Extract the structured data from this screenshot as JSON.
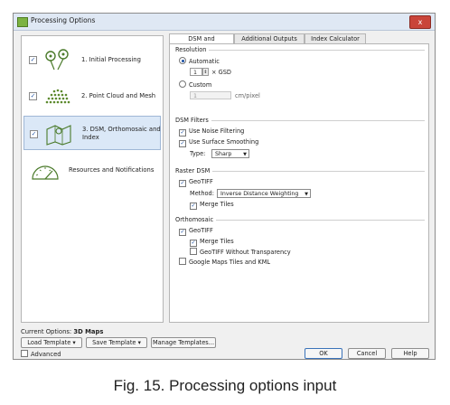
{
  "window": {
    "title": "Processing Options",
    "close_label": "x"
  },
  "steps": [
    {
      "label": "1. Initial Processing",
      "checked": true,
      "icon": "keypoints-icon"
    },
    {
      "label": "2. Point Cloud and Mesh",
      "checked": true,
      "icon": "point-cloud-icon"
    },
    {
      "label": "3. DSM, Orthomosaic and Index",
      "checked": true,
      "icon": "map-pins-icon"
    },
    {
      "label": "Resources and Notifications",
      "icon": "gauge-icon"
    }
  ],
  "tabs": [
    "DSM and Orthomosaic",
    "Additional Outputs",
    "Index Calculator"
  ],
  "resolution": {
    "title": "Resolution",
    "automatic_label": "Automatic",
    "gsd_value": "1",
    "gsd_unit": "× GSD",
    "custom_label": "Custom",
    "custom_value": "1",
    "custom_unit": "cm/pixel"
  },
  "dsm_filters": {
    "title": "DSM Filters",
    "noise_label": "Use Noise Filtering",
    "smoothing_label": "Use Surface Smoothing",
    "type_label": "Type:",
    "type_value": "Sharp"
  },
  "raster_dsm": {
    "title": "Raster DSM",
    "geotiff_label": "GeoTIFF",
    "method_label": "Method:",
    "method_value": "Inverse Distance Weighting",
    "merge_label": "Merge Tiles"
  },
  "orthomosaic": {
    "title": "Orthomosaic",
    "geotiff_label": "GeoTIFF",
    "merge_label": "Merge Tiles",
    "no_transparency_label": "GeoTIFF Without Transparency",
    "google_label": "Google Maps Tiles and KML"
  },
  "footer": {
    "current_options_label": "Current Options:",
    "current_options_value": "3D Maps",
    "load_template": "Load Template",
    "save_template": "Save Template",
    "manage_templates": "Manage Templates...",
    "advanced_label": "Advanced",
    "ok": "OK",
    "cancel": "Cancel",
    "help": "Help"
  },
  "check_glyph": "✓",
  "caption": "Fig. 15. Processing options input"
}
